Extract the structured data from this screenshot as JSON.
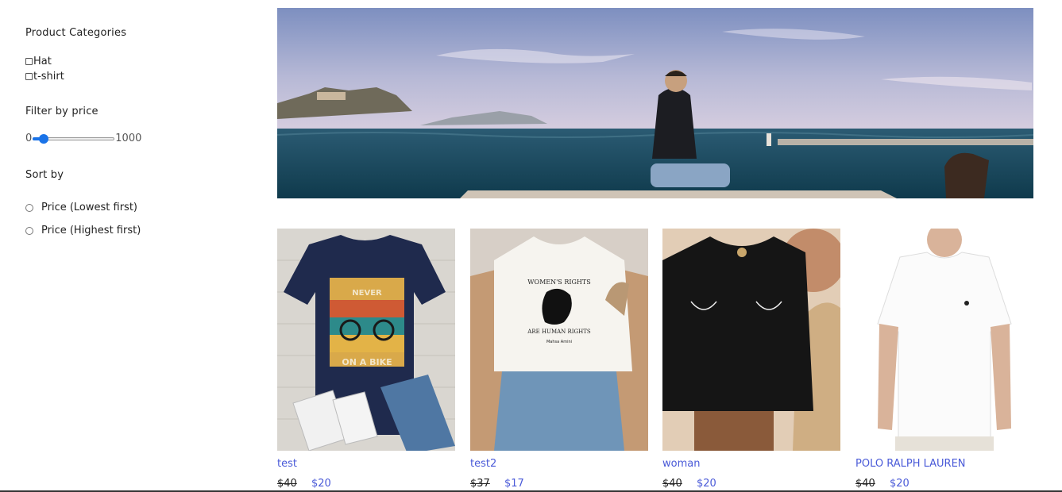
{
  "sidebar": {
    "categories_title": "Product Categories",
    "categories": [
      {
        "label": "Hat",
        "checked": false
      },
      {
        "label": "t-shirt",
        "checked": false
      }
    ],
    "price_filter": {
      "title": "Filter by price",
      "min_label": "0",
      "max_label": "1000",
      "value_fraction": 0.08
    },
    "sort": {
      "title": "Sort by",
      "options": [
        {
          "label": "Price (Lowest first)",
          "selected": false
        },
        {
          "label": "Price (Highest first)",
          "selected": false
        }
      ]
    }
  },
  "banner": {
    "description_icon": "sea-photo"
  },
  "products": [
    {
      "name": "test",
      "old_price": "$40",
      "price": "$20",
      "image": "navy-bike-tshirt",
      "shirt_color": "#1f2a4d",
      "bg_color": "#d6d4cf"
    },
    {
      "name": "test2",
      "old_price": "$37",
      "price": "$17",
      "image": "white-womens-rights-tshirt",
      "shirt_color": "#f6f4ef",
      "bg_color": "#c9b9ab"
    },
    {
      "name": "woman",
      "old_price": "$40",
      "price": "$20",
      "image": "black-tshirt-model",
      "shirt_color": "#151515",
      "bg_color": "#d9c1a8"
    },
    {
      "name": "POLO RALPH LAUREN",
      "old_price": "$40",
      "price": "$20",
      "image": "white-polo-tshirt",
      "shirt_color": "#fbfbfb",
      "bg_color": "#ffffff"
    }
  ],
  "colors": {
    "accent": "#1a73e8",
    "link": "#4a5ad8"
  }
}
